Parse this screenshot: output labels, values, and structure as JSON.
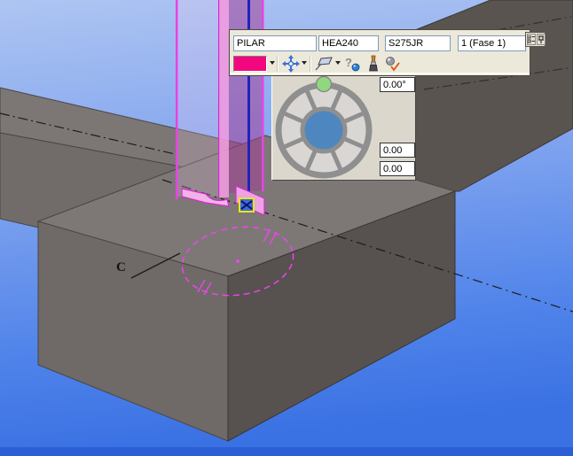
{
  "toolbar": {
    "name_value": "PILAR",
    "profile_value": "HEA240",
    "material_value": "S275JR",
    "phase_value": "1 (Fase 1)",
    "icons": [
      "color-swatch",
      "move-crosshair",
      "workplane-flag",
      "help-ball",
      "paintbrush",
      "apply-check"
    ],
    "window_icons": [
      "properties-grid",
      "pin"
    ]
  },
  "rotation_panel": {
    "angle_value": "0.00°",
    "offset1_value": "0.00",
    "offset2_value": "0.00"
  },
  "scene": {
    "grid_label": "C",
    "selected_part_color": "#f3077f",
    "column_pink": "#ef9ade",
    "column_edge_magenta": "#e544e5",
    "axis_blue": "#2222bb",
    "circle_magenta": "#ee44ee",
    "dial_hub_blue": "#4e87bf",
    "dial_knob_green": "#90d87f",
    "sky_top": "#aec5f2",
    "sky_bottom": "#2c5fd6",
    "concrete_top": "#7d7876",
    "concrete_front": "#6f6a67",
    "concrete_right": "#575150",
    "beam_dark": "#5a5450"
  }
}
